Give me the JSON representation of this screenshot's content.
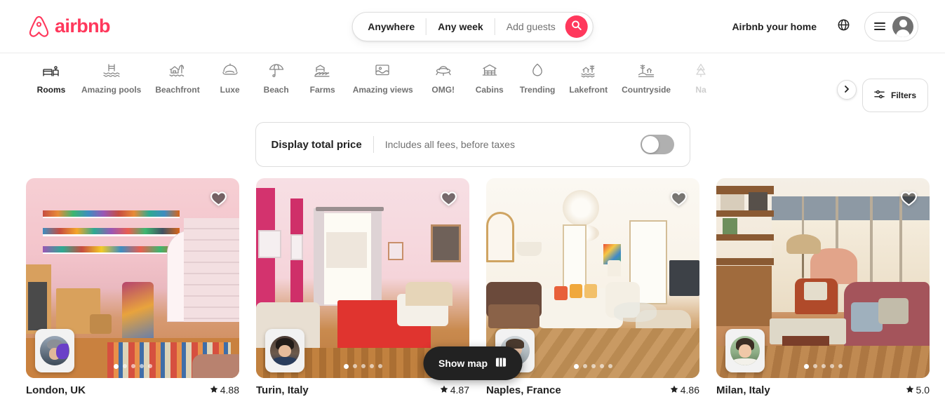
{
  "header": {
    "brand": "airbnb",
    "brand_color": "#FF385C",
    "logo_icon": "airbnb-bélo-icon",
    "search": {
      "where_label": "Anywhere",
      "when_label": "Any week",
      "guests_placeholder": "Add guests",
      "search_icon": "search-icon"
    },
    "host_link": "Airbnb your home",
    "globe_icon": "globe-icon",
    "menu_icon": "hamburger-menu-icon",
    "avatar_icon": "user-avatar-icon"
  },
  "categories": {
    "items": [
      {
        "label": "Rooms",
        "icon": "bed-room-icon",
        "active": true,
        "faded": false
      },
      {
        "label": "Amazing pools",
        "icon": "swimming-pool-icon",
        "active": false,
        "faded": false
      },
      {
        "label": "Beachfront",
        "icon": "beach-house-icon",
        "active": false,
        "faded": false
      },
      {
        "label": "Luxe",
        "icon": "cloche-dome-icon",
        "active": false,
        "faded": false
      },
      {
        "label": "Beach",
        "icon": "beach-umbrella-icon",
        "active": false,
        "faded": false
      },
      {
        "label": "Farms",
        "icon": "farm-barn-icon",
        "active": false,
        "faded": false
      },
      {
        "label": "Amazing views",
        "icon": "scenic-view-icon",
        "active": false,
        "faded": false
      },
      {
        "label": "OMG!",
        "icon": "ufo-icon",
        "active": false,
        "faded": false
      },
      {
        "label": "Cabins",
        "icon": "cabin-icon",
        "active": false,
        "faded": false
      },
      {
        "label": "Trending",
        "icon": "flame-icon",
        "active": false,
        "faded": false
      },
      {
        "label": "Lakefront",
        "icon": "lakefront-icon",
        "active": false,
        "faded": false
      },
      {
        "label": "Countryside",
        "icon": "countryside-icon",
        "active": false,
        "faded": false
      },
      {
        "label": "Na",
        "icon": "national-park-icon",
        "active": false,
        "faded": true
      }
    ],
    "next_arrow_icon": "chevron-right-icon",
    "filters_label": "Filters",
    "filters_icon": "filter-sliders-icon"
  },
  "price_panel": {
    "title": "Display total price",
    "subtitle": "Includes all fees, before taxes",
    "toggle_on": false,
    "toggle_name": "display-total-price-toggle"
  },
  "listings": [
    {
      "place": "London, UK",
      "rating": "4.88",
      "star_icon": "star-icon",
      "heart_icon": "heart-icon",
      "dots_total": 5,
      "dots_active": 0,
      "host_avatar_icon": "host-avatar-icon"
    },
    {
      "place": "Turin, Italy",
      "rating": "4.87",
      "star_icon": "star-icon",
      "heart_icon": "heart-icon",
      "dots_total": 5,
      "dots_active": 0,
      "host_avatar_icon": "host-avatar-icon"
    },
    {
      "place": "Naples, France",
      "rating": "4.86",
      "star_icon": "star-icon",
      "heart_icon": "heart-icon",
      "dots_total": 5,
      "dots_active": 0,
      "host_avatar_icon": "host-avatar-icon"
    },
    {
      "place": "Milan, Italy",
      "rating": "5.0",
      "star_icon": "star-icon",
      "heart_icon": "heart-icon",
      "dots_total": 5,
      "dots_active": 0,
      "host_avatar_icon": "host-avatar-icon"
    }
  ],
  "show_map": {
    "label": "Show map",
    "icon": "map-icon"
  }
}
